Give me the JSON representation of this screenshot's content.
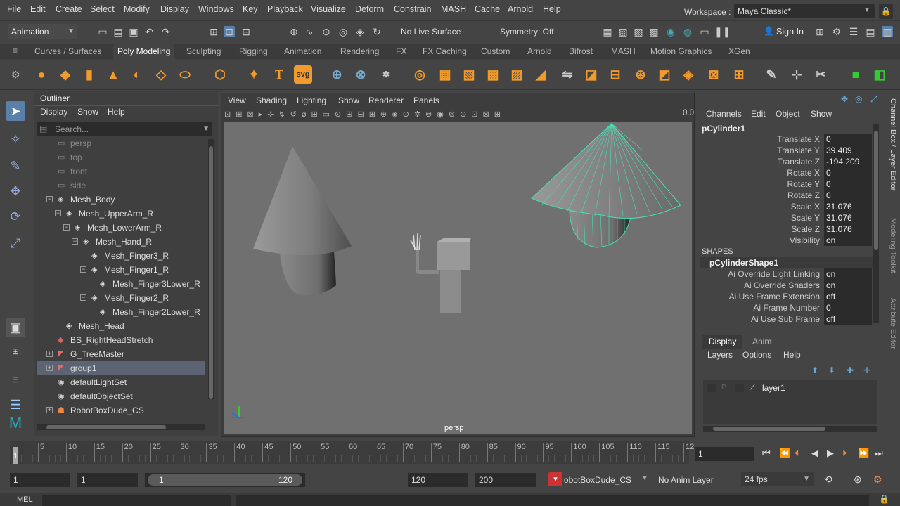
{
  "menubar": {
    "items": [
      "File",
      "Edit",
      "Create",
      "Select",
      "Modify",
      "Display",
      "Windows",
      "Key",
      "Playback",
      "Visualize",
      "Deform",
      "Constrain",
      "MASH",
      "Cache",
      "Arnold",
      "Help"
    ],
    "workspace_label": "Workspace :",
    "workspace_value": "Maya Classic*"
  },
  "statusline": {
    "mode": "Animation",
    "live_surface": "No Live Surface",
    "symmetry": "Symmetry: Off",
    "sign_in": "Sign In"
  },
  "shelf": {
    "tabs": [
      "Curves / Surfaces",
      "Poly Modeling",
      "Sculpting",
      "Rigging",
      "Animation",
      "Rendering",
      "FX",
      "FX Caching",
      "Custom",
      "Arnold",
      "Bifrost",
      "MASH",
      "Motion Graphics",
      "XGen"
    ],
    "active_tab": "Poly Modeling",
    "text_icons": [
      "T",
      "svg"
    ]
  },
  "outliner": {
    "title": "Outliner",
    "menu": [
      "Display",
      "Show",
      "Help"
    ],
    "search_placeholder": "Search...",
    "rows": [
      {
        "label": "persp",
        "indent": 0,
        "dim": true,
        "icon": "camera-icon"
      },
      {
        "label": "top",
        "indent": 0,
        "dim": true,
        "icon": "camera-icon"
      },
      {
        "label": "front",
        "indent": 0,
        "dim": true,
        "icon": "camera-icon"
      },
      {
        "label": "side",
        "indent": 0,
        "dim": true,
        "icon": "camera-icon"
      },
      {
        "label": "Mesh_Body",
        "indent": 0,
        "expander": "minus",
        "icon": "joint-icon"
      },
      {
        "label": "Mesh_UpperArm_R",
        "indent": 1,
        "expander": "minus",
        "icon": "joint-icon"
      },
      {
        "label": "Mesh_LowerArm_R",
        "indent": 2,
        "expander": "minus",
        "icon": "joint-icon"
      },
      {
        "label": "Mesh_Hand_R",
        "indent": 3,
        "expander": "minus",
        "icon": "joint-icon"
      },
      {
        "label": "Mesh_Finger3_R",
        "indent": 4,
        "icon": "joint-icon"
      },
      {
        "label": "Mesh_Finger1_R",
        "indent": 4,
        "expander": "minus",
        "icon": "joint-icon"
      },
      {
        "label": "Mesh_Finger3Lower_R",
        "indent": 5,
        "icon": "joint-icon"
      },
      {
        "label": "Mesh_Finger2_R",
        "indent": 4,
        "expander": "minus",
        "icon": "joint-icon"
      },
      {
        "label": "Mesh_Finger2Lower_R",
        "indent": 5,
        "icon": "joint-icon"
      },
      {
        "label": "Mesh_Head",
        "indent": 1,
        "icon": "joint-icon"
      },
      {
        "label": "BS_RightHeadStretch",
        "indent": 0,
        "icon": "blendshape-icon"
      },
      {
        "label": "G_TreeMaster",
        "indent": 0,
        "expander": "plus",
        "icon": "group-icon"
      },
      {
        "label": "group1",
        "indent": 0,
        "expander": "plus",
        "icon": "group-icon",
        "selected": true
      },
      {
        "label": "defaultLightSet",
        "indent": 0,
        "icon": "set-icon"
      },
      {
        "label": "defaultObjectSet",
        "indent": 0,
        "icon": "set-icon"
      },
      {
        "label": "RobotBoxDude_CS",
        "indent": 0,
        "expander": "plus",
        "icon": "character-icon"
      }
    ]
  },
  "viewport": {
    "menu": [
      "View",
      "Shading",
      "Lighting",
      "Show",
      "Renderer",
      "Panels"
    ],
    "camera_label": "persp",
    "toolbar_value": "0.0"
  },
  "channelbox": {
    "menu": [
      "Channels",
      "Edit",
      "Object",
      "Show"
    ],
    "object_name": "pCylinder1",
    "channels": [
      {
        "label": "Translate X",
        "value": "0"
      },
      {
        "label": "Translate Y",
        "value": "39.409"
      },
      {
        "label": "Translate Z",
        "value": "-194.209"
      },
      {
        "label": "Rotate X",
        "value": "0"
      },
      {
        "label": "Rotate Y",
        "value": "0"
      },
      {
        "label": "Rotate Z",
        "value": "0"
      },
      {
        "label": "Scale X",
        "value": "31.076"
      },
      {
        "label": "Scale Y",
        "value": "31.076"
      },
      {
        "label": "Scale Z",
        "value": "31.076"
      },
      {
        "label": "Visibility",
        "value": "on"
      }
    ],
    "shapes_header": "SHAPES",
    "shape_name": "pCylinderShape1",
    "shape_attrs": [
      {
        "label": "Ai Override Light Linking",
        "value": "on"
      },
      {
        "label": "Ai Override Shaders",
        "value": "on"
      },
      {
        "label": "Ai Use Frame Extension",
        "value": "off"
      },
      {
        "label": "Ai Frame Number",
        "value": "0"
      },
      {
        "label": "Ai Use Sub Frame",
        "value": "off"
      }
    ],
    "side_tabs": [
      "Channel Box / Layer Editor",
      "Modeling Toolkit",
      "Attribute Editor"
    ]
  },
  "layer_editor": {
    "tabs": [
      "Display",
      "Anim"
    ],
    "menu": [
      "Layers",
      "Options",
      "Help"
    ],
    "layer_flags": [
      "P"
    ],
    "layer_name": "layer1"
  },
  "timeline": {
    "ticks": [
      "5",
      "10",
      "15",
      "20",
      "25",
      "30",
      "35",
      "40",
      "45",
      "50",
      "55",
      "60",
      "65",
      "70",
      "75",
      "80",
      "85",
      "90",
      "95",
      "100",
      "105",
      "110",
      "115",
      "12"
    ],
    "current_marker": "1",
    "current_frame": "1"
  },
  "rangebar": {
    "start": "1",
    "anim_start": "1",
    "slider_start": "1",
    "slider_end": "120",
    "range_end": "120",
    "anim_end": "200",
    "character_set": "RobotBoxDude_CS",
    "anim_layer": "No Anim Layer",
    "fps": "24 fps"
  },
  "cmdline": {
    "label": "MEL"
  },
  "colors": {
    "selection": "#5c6474",
    "wireframe_highlight": "#46e0b4",
    "background": "#444444"
  }
}
